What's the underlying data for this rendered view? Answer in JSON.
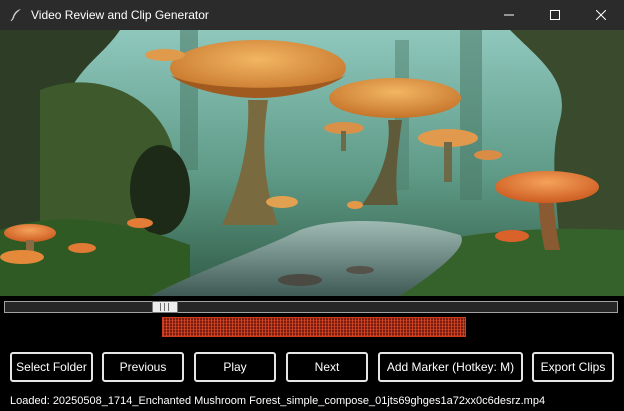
{
  "window": {
    "title": "Video Review and Clip Generator",
    "icon": "feather-icon"
  },
  "video": {
    "scene": "enchanted-mushroom-forest"
  },
  "seekbar": {
    "position_fraction": 0.26
  },
  "marker_range": {
    "start_fraction": 0.258,
    "end_fraction": 0.753,
    "color": "#d03a1e"
  },
  "buttons": {
    "select_folder": "Select Folder",
    "previous": "Previous",
    "play": "Play",
    "next": "Next",
    "add_marker": "Add Marker (Hotkey: M)",
    "export_clips": "Export Clips"
  },
  "status": {
    "text": "Loaded: 20250508_1714_Enchanted Mushroom Forest_simple_compose_01jts69ghges1a72xx0c6desrz.mp4"
  }
}
